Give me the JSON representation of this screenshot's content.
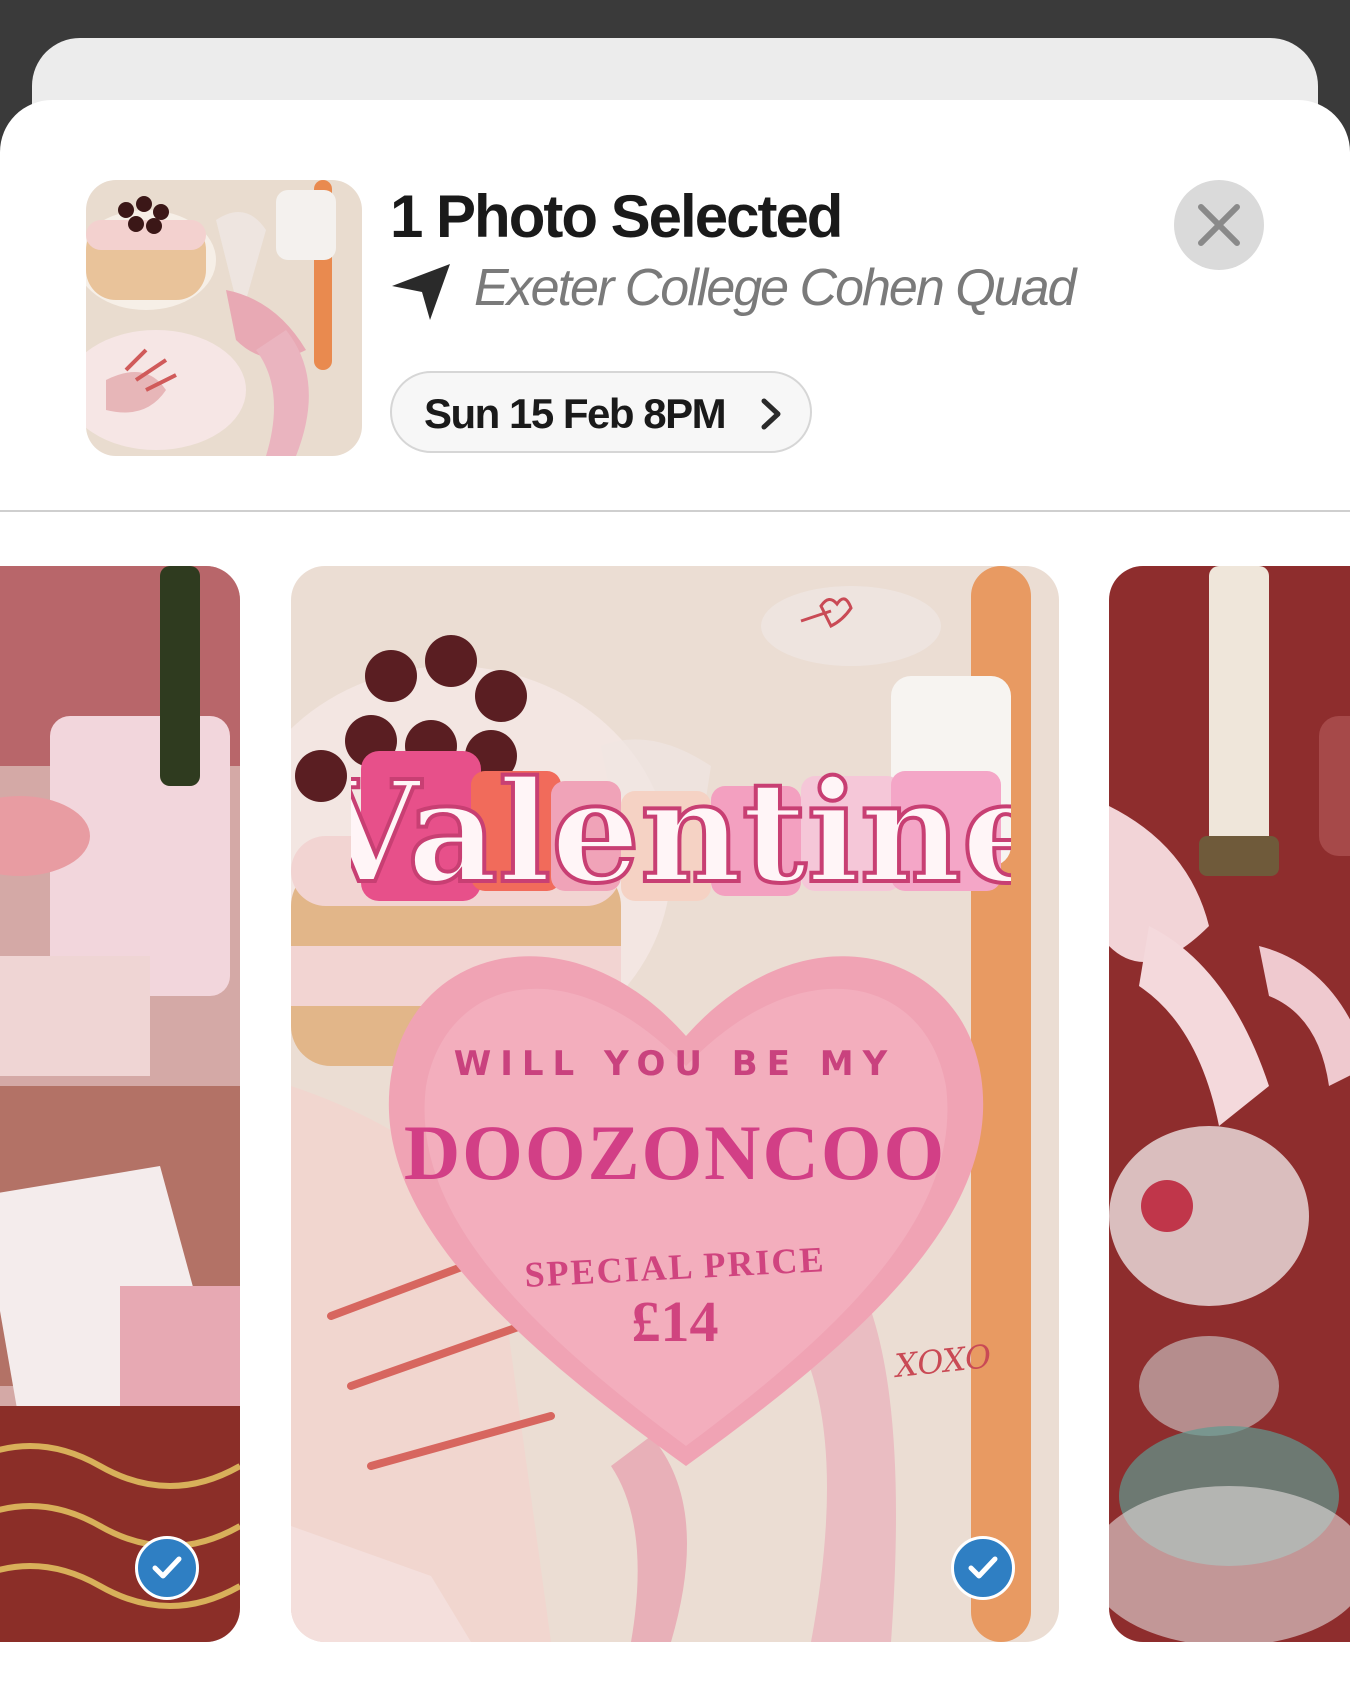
{
  "header": {
    "title": "1 Photo Selected",
    "location": "Exeter College Cohen Quad",
    "date_label": "Sun 15 Feb 8PM"
  },
  "icons": {
    "location": "location-arrow-icon",
    "chevron": "chevron-right-icon",
    "close": "close-icon",
    "check": "checkmark-icon"
  },
  "photos": [
    {
      "position": "left",
      "selected": true
    },
    {
      "position": "center",
      "selected": true
    },
    {
      "position": "right",
      "selected": false
    }
  ],
  "poster": {
    "headline": "Valentine",
    "line1": "WILL YOU BE MY",
    "line2": "DOOZONCOO",
    "line3": "SPECIAL PRICE",
    "price": "£14",
    "signoff": "XOXO"
  },
  "colors": {
    "check_blue": "#2f7fc3",
    "poster_pink": "#d23f86",
    "sheet_bg": "#ffffff"
  }
}
